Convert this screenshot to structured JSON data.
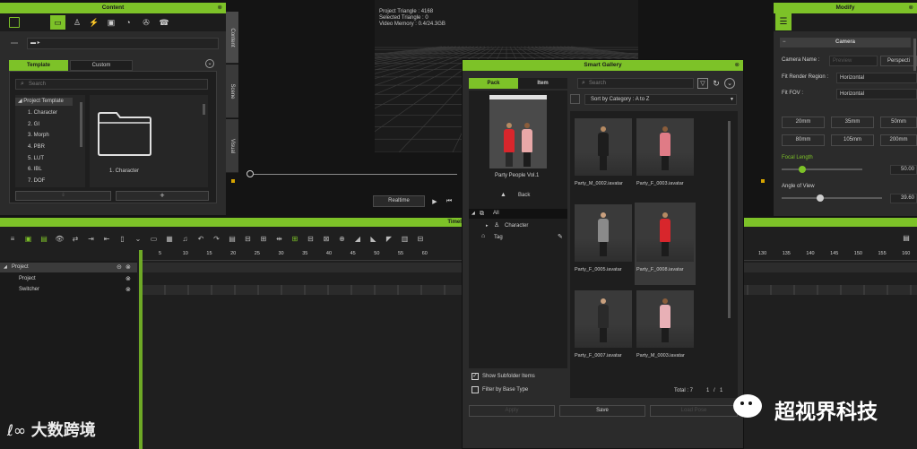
{
  "content_panel": {
    "title": "Content",
    "close": "⊗",
    "side_tabs": [
      "Content",
      "Scene",
      "Visual"
    ],
    "tabs": [
      "Template",
      "Custom"
    ],
    "search_placeholder": "Search",
    "tree_root": "Project Template",
    "tree_items": [
      "1. Character",
      "2. GI",
      "3. Morph",
      "4. PBR",
      "5. LUT",
      "6. IBL",
      "7. DOF"
    ],
    "folder_label": "1. Character",
    "add": "+"
  },
  "viewport": {
    "stats": [
      "Project Triangle : 4168",
      "Selected Triangle : 0",
      "Video Memory : 0.4/24.3GB"
    ],
    "realtime_label": "Realtime",
    "play": "▶",
    "step": "⏮"
  },
  "modify": {
    "title": "Modify",
    "close": "⊗",
    "section": "Camera",
    "camera_name_label": "Camera Name :",
    "camera_name_value": "Preview",
    "perspective": "Perspecti",
    "fit_render_label": "Fit Render Region :",
    "fit_render_value": "Horizontal",
    "fit_fov_label": "Fit FOV :",
    "fit_fov_value": "Horizontal",
    "lenses_row1": [
      "20mm",
      "35mm",
      "50mm"
    ],
    "lenses_row2": [
      "80mm",
      "105mm",
      "200mm"
    ],
    "focal_label": "Focal Length",
    "focal_value": "50.00",
    "focal_level": 0.25,
    "aov_label": "Angle of View",
    "aov_value": "39.60",
    "aov_level": 0.38
  },
  "timeline": {
    "title": "Timeline",
    "tracks": [
      "Project",
      "Project",
      "Switcher"
    ],
    "ticks_left": [
      "5",
      "10",
      "15",
      "20",
      "25",
      "30",
      "35",
      "40",
      "45",
      "50",
      "55",
      "60"
    ],
    "ticks_right": [
      "130",
      "135",
      "140",
      "145",
      "150",
      "155",
      "160"
    ]
  },
  "gallery": {
    "title": "Smart Gallery",
    "close": "⊗",
    "tabs": [
      "Pack",
      "Item"
    ],
    "search_placeholder": "Search",
    "sort_label": "Sort by Category : A to Z",
    "pack_name": "Party People Vol.1",
    "back_label": "Back",
    "tree_all": "All",
    "tree_character": "Character",
    "tree_tag": "Tag",
    "show_subfolder": "Show Subfolder Items",
    "filter_base": "Filter by Base Type",
    "items": [
      "Party_M_0002.iavatar",
      "Party_F_0003.iavatar",
      "Party_F_0005.iavatar",
      "Party_F_0008.iavatar",
      "Party_F_0007.iavatar",
      "Party_M_0003.iavatar"
    ],
    "total": "Total : 7",
    "page": "1",
    "page_of": "1",
    "footer_buttons": [
      "Apply",
      "Save",
      "Load Pose"
    ]
  },
  "watermarks": {
    "left": "大数跨境",
    "right": "超视界科技"
  },
  "colors": {
    "accent": "#7dc228"
  }
}
